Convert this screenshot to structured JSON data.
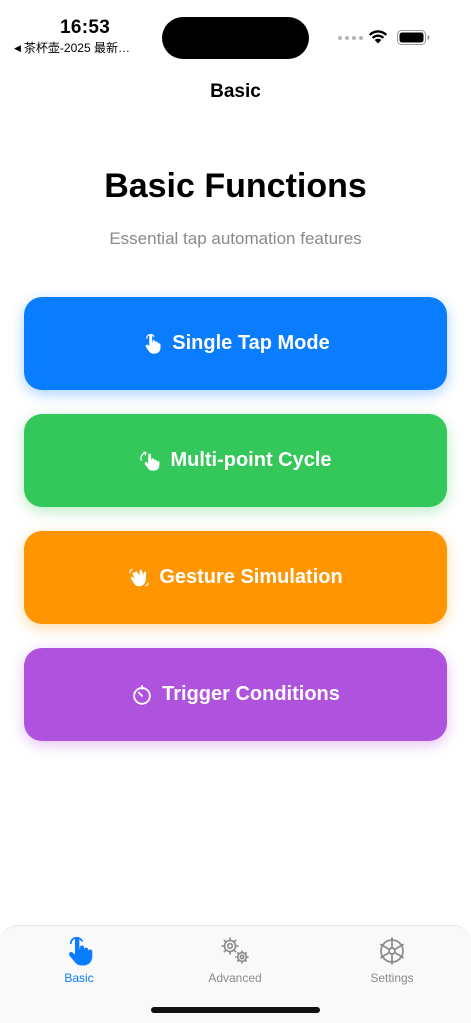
{
  "status_bar": {
    "time": "16:53",
    "back_app": "茶杯壶-2025 最新…"
  },
  "nav": {
    "title": "Basic"
  },
  "header": {
    "title": "Basic Functions",
    "subtitle": "Essential tap automation features"
  },
  "buttons": [
    {
      "label": "Single Tap Mode",
      "icon": "hand-tap-icon",
      "color": "#0a7cff"
    },
    {
      "label": "Multi-point Cycle",
      "icon": "hand-cycle-icon",
      "color": "#34c759"
    },
    {
      "label": "Gesture Simulation",
      "icon": "hand-wave-icon",
      "color": "#ff9500"
    },
    {
      "label": "Trigger Conditions",
      "icon": "timer-icon",
      "color": "#af52de"
    }
  ],
  "tabs": [
    {
      "label": "Basic",
      "icon": "hand-tap-icon",
      "active": true
    },
    {
      "label": "Advanced",
      "icon": "gears-icon",
      "active": false
    },
    {
      "label": "Settings",
      "icon": "helm-icon",
      "active": false
    }
  ],
  "colors": {
    "accent": "#0a7cff",
    "inactive": "#8a8a8e"
  }
}
